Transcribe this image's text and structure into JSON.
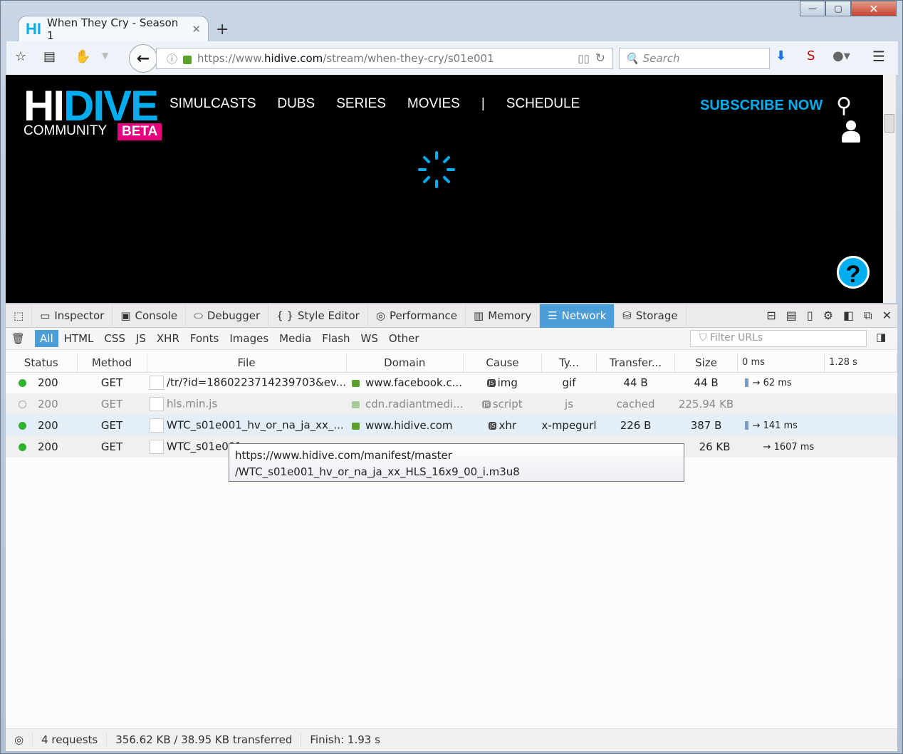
{
  "browser": {
    "tab_title": "When They Cry - Season 1",
    "tab_icon_text": "HI",
    "url_scheme": "https://www.",
    "url_host": "hidive.com",
    "url_path": "/stream/when-they-cry/s01e001",
    "search_placeholder": "Search"
  },
  "site": {
    "logo_hi": "HI",
    "logo_dive": "DIVE",
    "community": "COMMUNITY",
    "beta": "BETA",
    "nav": [
      "SIMULCASTS",
      "DUBS",
      "SERIES",
      "MOVIES",
      "|",
      "SCHEDULE"
    ],
    "subscribe": "SUBSCRIBE NOW",
    "help": "?"
  },
  "devtools": {
    "tabs": [
      "Inspector",
      "Console",
      "Debugger",
      "Style Editor",
      "Performance",
      "Memory",
      "Network",
      "Storage"
    ],
    "active_tab": "Network",
    "filters": [
      "All",
      "HTML",
      "CSS",
      "JS",
      "XHR",
      "Fonts",
      "Images",
      "Media",
      "Flash",
      "WS",
      "Other"
    ],
    "filter_placeholder": "Filter URLs",
    "columns": [
      "Status",
      "Method",
      "File",
      "Domain",
      "Cause",
      "Ty...",
      "Transfer...",
      "Size",
      "0 ms",
      "1.28 s"
    ],
    "rows": [
      {
        "status": "200",
        "method": "GET",
        "file": "/tr/?id=1860223714239703&ev...",
        "domain": "www.facebook.c...",
        "cause": "img",
        "type": "gif",
        "transferred": "44 B",
        "size": "44 B",
        "timing": "→ 62 ms"
      },
      {
        "status": "200",
        "method": "GET",
        "file": "hls.min.js",
        "domain": "cdn.radiantmedi...",
        "cause": "script",
        "type": "js",
        "transferred": "cached",
        "size": "225.94 KB",
        "timing": ""
      },
      {
        "status": "200",
        "method": "GET",
        "file": "WTC_s01e001_hv_or_na_ja_xx_...",
        "domain": "www.hidive.com",
        "cause": "xhr",
        "type": "x-mpegurl",
        "transferred": "226 B",
        "size": "387 B",
        "timing": "→ 141 ms"
      },
      {
        "status": "200",
        "method": "GET",
        "file": "WTC_s01e001_...",
        "domain": "",
        "cause": "",
        "type": "",
        "transferred": "",
        "size": "26 KB",
        "timing": "→ 1607 ms"
      }
    ],
    "tooltip_line1": "https://www.hidive.com/manifest/master",
    "tooltip_line2": "/WTC_s01e001_hv_or_na_ja_xx_HLS_16x9_00_i.m3u8",
    "status": {
      "requests": "4 requests",
      "size": "356.62 KB / 38.95 KB transferred",
      "finish": "Finish: 1.93 s"
    }
  }
}
